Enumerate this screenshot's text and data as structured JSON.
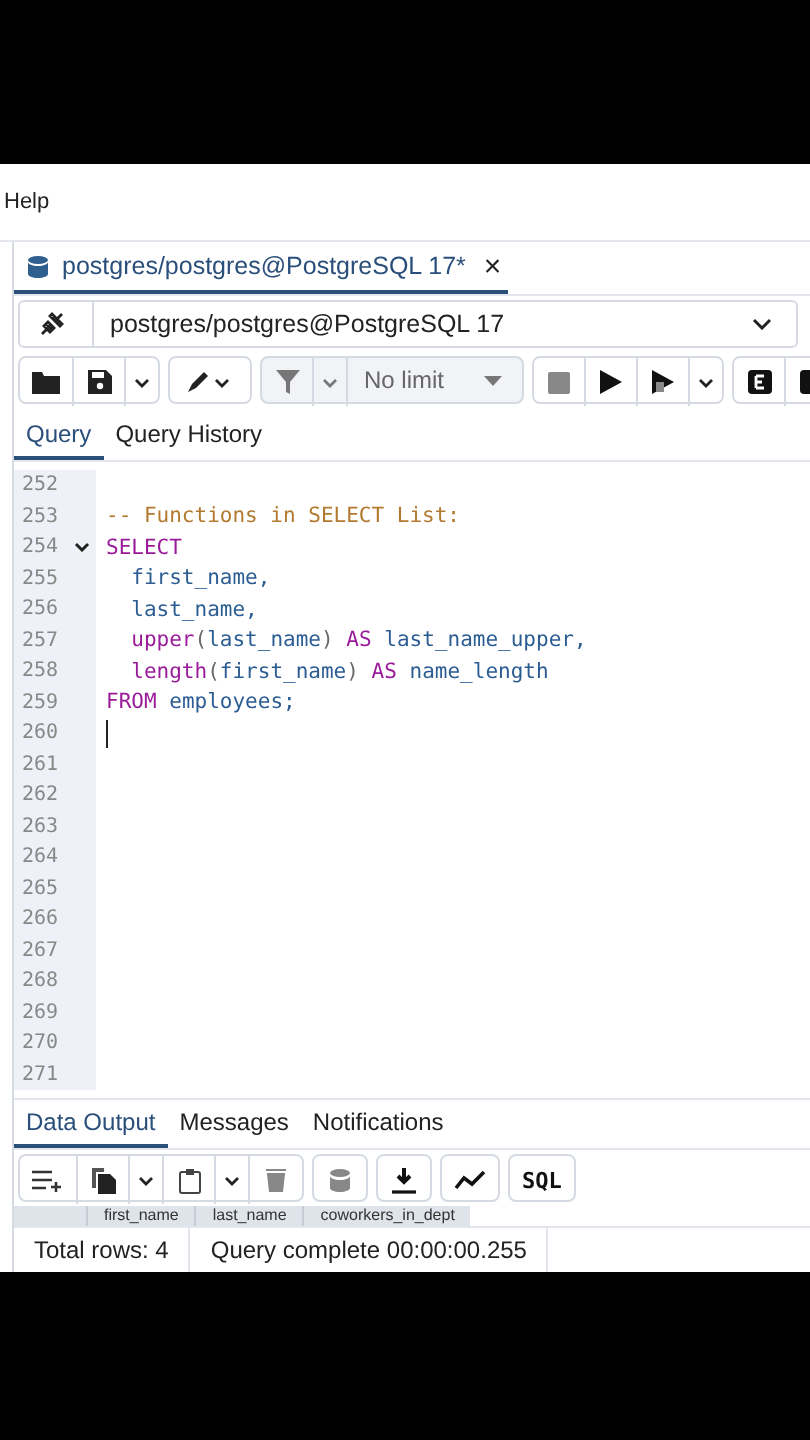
{
  "menu": {
    "items": [
      "Help"
    ]
  },
  "document_tab": {
    "title": "postgres/postgres@PostgreSQL 17*",
    "close": "×",
    "selected": true
  },
  "connection": {
    "value": "postgres/postgres@PostgreSQL 17"
  },
  "toolbar": {
    "limit": "No limit"
  },
  "editor_tabs": [
    {
      "label": "Query",
      "selected": true
    },
    {
      "label": "Query History",
      "selected": false
    }
  ],
  "editor": {
    "lines": [
      {
        "number": "252",
        "fold": false,
        "cursor": false
      },
      {
        "number": "253",
        "fold": false,
        "cursor": false,
        "tokens": [
          {
            "kind": "comment",
            "text": "-- Functions in SELECT List:"
          }
        ]
      },
      {
        "number": "254",
        "fold": true,
        "cursor": false,
        "tokens": [
          {
            "kind": "keyword",
            "text": "SELECT"
          }
        ]
      },
      {
        "number": "255",
        "fold": false,
        "cursor": false,
        "tokens": [
          {
            "kind": "ident",
            "text": "  first_name,"
          }
        ]
      },
      {
        "number": "256",
        "fold": false,
        "cursor": false,
        "tokens": [
          {
            "kind": "ident",
            "text": "  last_name,"
          }
        ]
      },
      {
        "number": "257",
        "fold": false,
        "cursor": false,
        "tokens": [
          {
            "kind": "keyword",
            "text": "  upper"
          },
          {
            "kind": "punct",
            "text": "("
          },
          {
            "kind": "ident",
            "text": "last_name"
          },
          {
            "kind": "punct",
            "text": ") "
          },
          {
            "kind": "keyword",
            "text": "AS"
          },
          {
            "kind": "ident",
            "text": " last_name_upper,"
          }
        ]
      },
      {
        "number": "258",
        "fold": false,
        "cursor": false,
        "tokens": [
          {
            "kind": "keyword",
            "text": "  length"
          },
          {
            "kind": "punct",
            "text": "("
          },
          {
            "kind": "ident",
            "text": "first_name"
          },
          {
            "kind": "punct",
            "text": ") "
          },
          {
            "kind": "keyword",
            "text": "AS"
          },
          {
            "kind": "ident",
            "text": " name_length"
          }
        ]
      },
      {
        "number": "259",
        "fold": false,
        "cursor": false,
        "tokens": [
          {
            "kind": "keyword",
            "text": "FROM"
          },
          {
            "kind": "ident",
            "text": " employees;"
          }
        ]
      },
      {
        "number": "260",
        "fold": false,
        "cursor": true
      },
      {
        "number": "261",
        "fold": false,
        "cursor": false
      },
      {
        "number": "262",
        "fold": false,
        "cursor": false
      },
      {
        "number": "263",
        "fold": false,
        "cursor": false
      },
      {
        "number": "264",
        "fold": false,
        "cursor": false
      },
      {
        "number": "265",
        "fold": false,
        "cursor": false
      },
      {
        "number": "266",
        "fold": false,
        "cursor": false
      },
      {
        "number": "267",
        "fold": false,
        "cursor": false
      },
      {
        "number": "268",
        "fold": false,
        "cursor": false
      },
      {
        "number": "269",
        "fold": false,
        "cursor": false
      },
      {
        "number": "270",
        "fold": false,
        "cursor": false
      },
      {
        "number": "271",
        "fold": false,
        "cursor": false
      }
    ]
  },
  "output_tabs": [
    {
      "label": "Data Output",
      "selected": true
    },
    {
      "label": "Messages",
      "selected": false
    },
    {
      "label": "Notifications",
      "selected": false
    }
  ],
  "output_toolbar": {
    "sql_button": "SQL"
  },
  "table": {
    "columns": [
      "first_name",
      "last_name",
      "coworkers_in_dept"
    ]
  },
  "status_bar": {
    "total_rows": "Total rows: 4",
    "query_status": "Query complete 00:00:00.255"
  }
}
